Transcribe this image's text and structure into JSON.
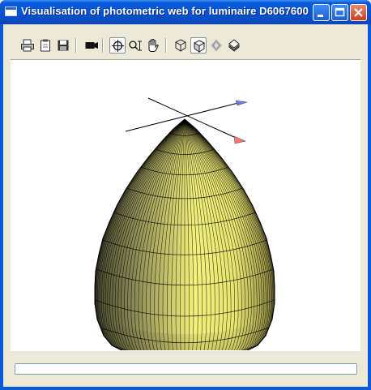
{
  "window": {
    "title": "Visualisation of photometric web for luminaire D6067600"
  },
  "toolbar": {
    "tools": [
      {
        "name": "print-icon"
      },
      {
        "name": "clipboard-icon"
      },
      {
        "name": "save-icon"
      },
      {
        "name": "camera-icon"
      },
      {
        "name": "rotate-icon",
        "pressed": true
      },
      {
        "name": "zoom-icon"
      },
      {
        "name": "pan-hand-icon"
      },
      {
        "name": "wireframe-cube-icon"
      },
      {
        "name": "shaded-cube-icon",
        "pressed": true
      },
      {
        "name": "solid-diamond-icon",
        "disabled": true
      },
      {
        "name": "layered-diamond-icon"
      }
    ]
  },
  "view": {
    "surface_color": "#f3f07a",
    "mesh_color": "#000000",
    "axis_colors": {
      "x": "#ff7777",
      "y": "#6b78e6"
    }
  },
  "status": {
    "text": ""
  }
}
